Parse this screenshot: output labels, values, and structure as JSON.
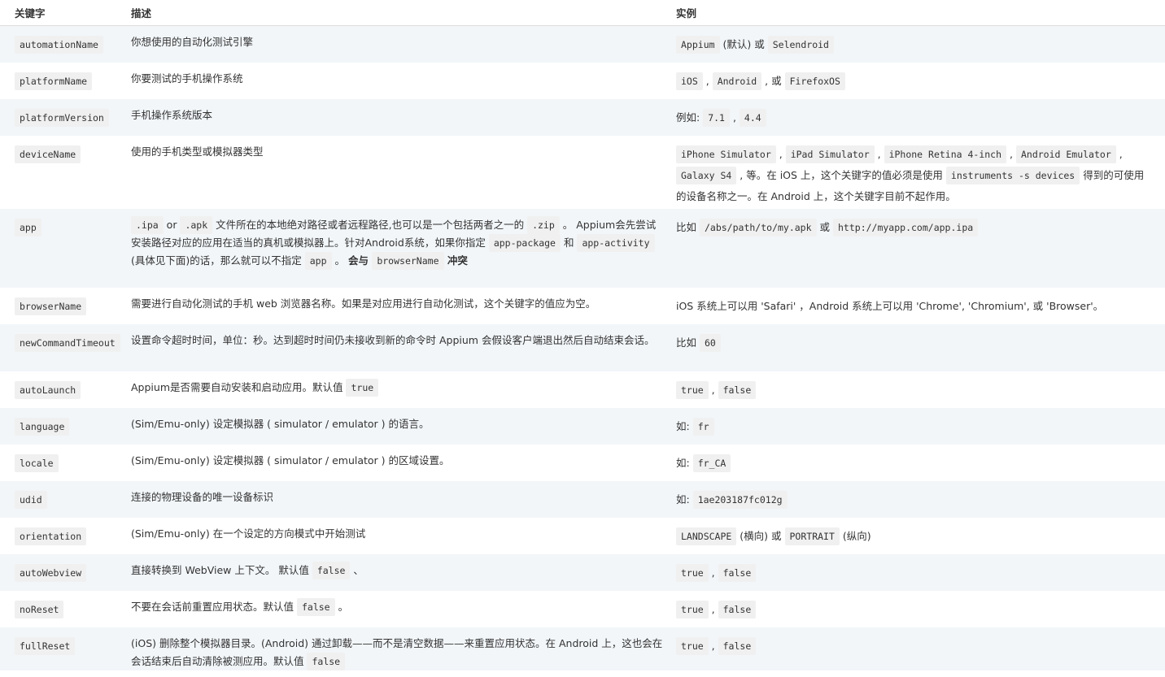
{
  "headers": {
    "keyword": "关键字",
    "description": "描述",
    "example": "实例"
  },
  "rows": [
    {
      "key": "automationName",
      "desc": [
        {
          "t": "你想使用的自动化测试引擎"
        }
      ],
      "example": [
        {
          "c": "Appium"
        },
        {
          "t": " (默认) 或 "
        },
        {
          "c": "Selendroid"
        }
      ]
    },
    {
      "key": "platformName",
      "desc": [
        {
          "t": "你要测试的手机操作系统"
        }
      ],
      "example": [
        {
          "c": "iOS"
        },
        {
          "t": " , "
        },
        {
          "c": "Android"
        },
        {
          "t": " , 或 "
        },
        {
          "c": "FirefoxOS"
        }
      ]
    },
    {
      "key": "platformVersion",
      "desc": [
        {
          "t": "手机操作系统版本"
        }
      ],
      "example": [
        {
          "t": "例如: "
        },
        {
          "c": "7.1"
        },
        {
          "t": " , "
        },
        {
          "c": "4.4"
        }
      ]
    },
    {
      "key": "deviceName",
      "desc": [
        {
          "t": "使用的手机类型或模拟器类型"
        }
      ],
      "example": [
        {
          "c": "iPhone Simulator"
        },
        {
          "t": " , "
        },
        {
          "c": "iPad Simulator"
        },
        {
          "t": " , "
        },
        {
          "c": "iPhone Retina 4-inch"
        },
        {
          "t": " , "
        },
        {
          "c": "Android Emulator"
        },
        {
          "t": " , "
        },
        {
          "c": "Galaxy S4"
        },
        {
          "t": " , 等。在 iOS 上，这个关键字的值必须是使用 "
        },
        {
          "c": "instruments -s devices"
        },
        {
          "t": " 得到的可使用的设备名称之一。在 Android 上，这个关键字目前不起作用。"
        }
      ]
    },
    {
      "key": "app",
      "desc": [
        {
          "c": ".ipa"
        },
        {
          "t": " or "
        },
        {
          "c": ".apk"
        },
        {
          "t": " 文件所在的本地绝对路径或者远程路径,也可以是一个包括两者之一的 "
        },
        {
          "c": ".zip"
        },
        {
          "t": " 。 Appium会先尝试安装路径对应的应用在适当的真机或模拟器上。针对Android系统，如果你指定 "
        },
        {
          "c": "app-package"
        },
        {
          "t": " 和 "
        },
        {
          "c": "app-activity"
        },
        {
          "t": " (具体见下面)的话，那么就可以不指定 "
        },
        {
          "c": "app"
        },
        {
          "t": " 。 "
        },
        {
          "b": "会与 "
        },
        {
          "c": "browserName"
        },
        {
          "b": " 冲突"
        }
      ],
      "example": [
        {
          "t": "比如 "
        },
        {
          "c": "/abs/path/to/my.apk"
        },
        {
          "t": " 或 "
        },
        {
          "c": "http://myapp.com/app.ipa"
        }
      ]
    },
    {
      "key": "browserName",
      "desc": [
        {
          "t": "需要进行自动化测试的手机 web 浏览器名称。如果是对应用进行自动化测试，这个关键字的值应为空。"
        }
      ],
      "example": [
        {
          "t": "iOS 系统上可以用 'Safari' ，Android 系统上可以用 'Chrome', 'Chromium', 或 'Browser'。"
        }
      ]
    },
    {
      "key": "newCommandTimeout",
      "desc": [
        {
          "t": "设置命令超时时间，单位：秒。达到超时时间仍未接收到新的命令时 Appium 会假设客户端退出然后自动结束会话。"
        }
      ],
      "example": [
        {
          "t": "比如 "
        },
        {
          "c": "60"
        }
      ]
    },
    {
      "key": "autoLaunch",
      "desc": [
        {
          "t": "Appium是否需要自动安装和启动应用。默认值 "
        },
        {
          "c": "true"
        }
      ],
      "example": [
        {
          "c": "true"
        },
        {
          "t": " , "
        },
        {
          "c": "false"
        }
      ]
    },
    {
      "key": "language",
      "desc": [
        {
          "t": "(Sim/Emu-only) 设定模拟器 ( simulator / emulator ) 的语言。"
        }
      ],
      "example": [
        {
          "t": "如: "
        },
        {
          "c": "fr"
        }
      ]
    },
    {
      "key": "locale",
      "desc": [
        {
          "t": "(Sim/Emu-only) 设定模拟器 ( simulator / emulator ) 的区域设置。"
        }
      ],
      "example": [
        {
          "t": "如: "
        },
        {
          "c": "fr_CA"
        }
      ]
    },
    {
      "key": "udid",
      "desc": [
        {
          "t": "连接的物理设备的唯一设备标识"
        }
      ],
      "example": [
        {
          "t": "如: "
        },
        {
          "c": "1ae203187fc012g"
        }
      ]
    },
    {
      "key": "orientation",
      "desc": [
        {
          "t": "(Sim/Emu-only) 在一个设定的方向模式中开始测试"
        }
      ],
      "example": [
        {
          "c": "LANDSCAPE"
        },
        {
          "t": " (横向) 或 "
        },
        {
          "c": "PORTRAIT"
        },
        {
          "t": " (纵向)"
        }
      ]
    },
    {
      "key": "autoWebview",
      "desc": [
        {
          "t": "直接转换到 WebView 上下文。 默认值 "
        },
        {
          "c": "false"
        },
        {
          "t": " 、"
        }
      ],
      "example": [
        {
          "c": "true"
        },
        {
          "t": " , "
        },
        {
          "c": "false"
        }
      ]
    },
    {
      "key": "noReset",
      "desc": [
        {
          "t": "不要在会话前重置应用状态。默认值 "
        },
        {
          "c": "false"
        },
        {
          "t": " 。"
        }
      ],
      "example": [
        {
          "c": "true"
        },
        {
          "t": " , "
        },
        {
          "c": "false"
        }
      ]
    },
    {
      "key": "fullReset",
      "desc": [
        {
          "t": "(iOS) 删除整个模拟器目录。(Android) 通过卸载——而不是清空数据——来重置应用状态。在 Android 上，这也会在会话结束后自动清除被测应用。默认值 "
        },
        {
          "c": "false"
        }
      ],
      "example": [
        {
          "c": "true"
        },
        {
          "t": " , "
        },
        {
          "c": "false"
        }
      ]
    }
  ]
}
